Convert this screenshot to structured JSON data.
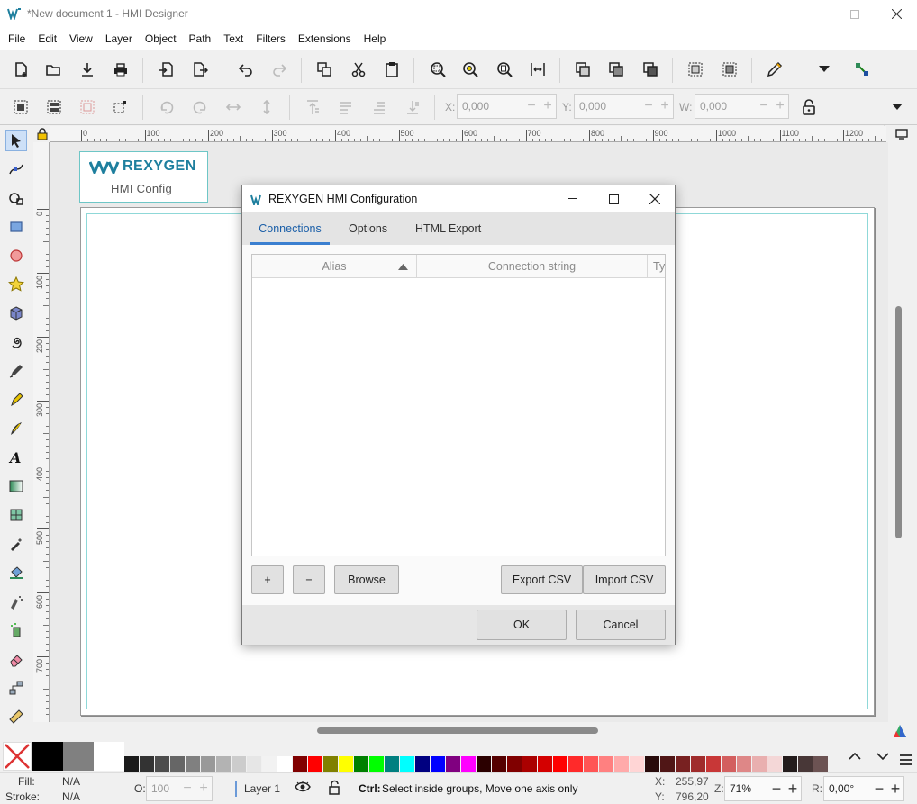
{
  "window": {
    "title": "*New document 1 - HMI Designer"
  },
  "menu": [
    "File",
    "Edit",
    "View",
    "Layer",
    "Object",
    "Path",
    "Text",
    "Filters",
    "Extensions",
    "Help"
  ],
  "toolbar2": {
    "x_label": "X:",
    "x_value": "0,000",
    "y_label": "Y:",
    "y_value": "0,000",
    "w_label": "W:",
    "w_value": "0,000"
  },
  "ruler_h": [
    "0",
    "100",
    "200",
    "300",
    "400",
    "500",
    "600",
    "700",
    "800",
    "900",
    "1000",
    "1100",
    "1200"
  ],
  "ruler_v": [
    "0",
    "100",
    "200",
    "300",
    "400",
    "500",
    "600",
    "700"
  ],
  "logo": {
    "brand": "REXYGEN",
    "subtitle": "HMI Config",
    "color": "#1e7f9e"
  },
  "dialog": {
    "title": "REXYGEN HMI Configuration",
    "tabs": [
      "Connections",
      "Options",
      "HTML Export"
    ],
    "active_tab": "Connections",
    "columns": [
      "Alias",
      "Connection string",
      "Ty"
    ],
    "buttons": {
      "add": "+",
      "remove": "−",
      "browse": "Browse",
      "export_csv": "Export CSV",
      "import_csv": "Import CSV",
      "ok": "OK",
      "cancel": "Cancel"
    }
  },
  "palette": [
    "#1a1a1a",
    "#333333",
    "#4d4d4d",
    "#666666",
    "#808080",
    "#999999",
    "#b3b3b3",
    "#cccccc",
    "#e6e6e6",
    "#f2f2f2",
    "#ffffff",
    "#800000",
    "#ff0000",
    "#808000",
    "#ffff00",
    "#008000",
    "#00ff00",
    "#008080",
    "#00ffff",
    "#000080",
    "#0000ff",
    "#800080",
    "#ff00ff",
    "#2b0000",
    "#550000",
    "#800000",
    "#aa0000",
    "#d40000",
    "#ff0000",
    "#ff2a2a",
    "#ff5555",
    "#ff8080",
    "#ffaaaa",
    "#ffd5d5",
    "#280b0b",
    "#501616",
    "#782121",
    "#a02c2c",
    "#c83737",
    "#d35f5f",
    "#de8787",
    "#e9afaf",
    "#f4d7d7",
    "#241c1c",
    "#483737",
    "#6c5353"
  ],
  "status": {
    "fill_label": "Fill:",
    "fill_value": "N/A",
    "stroke_label": "Stroke:",
    "stroke_value": "N/A",
    "opacity_label": "O:",
    "opacity_value": "100",
    "layer": "Layer 1",
    "message_key": "Ctrl:",
    "message": "Select inside groups, Move one axis only",
    "x_label": "X:",
    "x_value": "255,97",
    "y_label": "Y:",
    "y_value": "796,20",
    "zoom_label": "Z:",
    "zoom_value": "71%",
    "rotate_label": "R:",
    "rotate_value": "0,00°"
  }
}
